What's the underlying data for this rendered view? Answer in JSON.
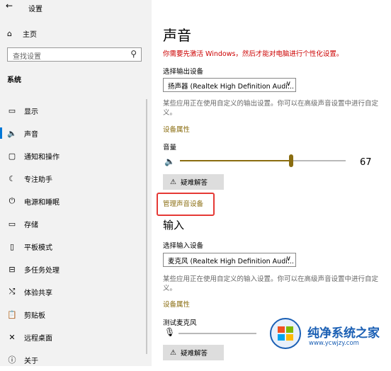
{
  "app": {
    "title": "设置",
    "back_icon": "←"
  },
  "sidebar": {
    "home": {
      "icon": "home-icon",
      "glyph": "⌂",
      "label": "主页"
    },
    "search": {
      "placeholder": "查找设置",
      "icon_glyph": "⚲"
    },
    "section": "系统",
    "items": [
      {
        "name": "display",
        "label": "显示",
        "glyph": "▭"
      },
      {
        "name": "sound",
        "label": "声音",
        "glyph": "🔈",
        "active": true
      },
      {
        "name": "notifications",
        "label": "通知和操作",
        "glyph": "▢"
      },
      {
        "name": "focus-assist",
        "label": "专注助手",
        "glyph": "☾"
      },
      {
        "name": "power-sleep",
        "label": "电源和睡眠",
        "glyph": "⏻"
      },
      {
        "name": "storage",
        "label": "存储",
        "glyph": "▭"
      },
      {
        "name": "tablet-mode",
        "label": "平板模式",
        "glyph": "▯"
      },
      {
        "name": "multitasking",
        "label": "多任务处理",
        "glyph": "⊟"
      },
      {
        "name": "project",
        "label": "体验共享",
        "glyph": "⤭"
      },
      {
        "name": "clipboard",
        "label": "剪贴板",
        "glyph": "📋"
      },
      {
        "name": "remote-desktop",
        "label": "远程桌面",
        "glyph": "✕"
      },
      {
        "name": "about",
        "label": "关于",
        "glyph": "ⓘ"
      }
    ]
  },
  "main": {
    "title": "声音",
    "warning": "你需要先激活 Windows，然后才能对电脑进行个性化设置。",
    "output": {
      "label": "选择输出设备",
      "device": "扬声器 (Realtek High Definition Audi...",
      "description": "某些应用正在使用自定义的输出设置。你可以在高级声音设置中进行自定义。",
      "properties_link": "设备属性",
      "volume_label": "音量",
      "volume": 67,
      "troubleshoot": "疑难解答",
      "manage_link": "管理声音设备"
    },
    "input": {
      "heading": "输入",
      "label": "选择输入设备",
      "device": "麦克风 (Realtek High Definition Audi...",
      "description": "某些应用正在使用自定义的输入设置。你可以在高级声音设置中进行自定义。",
      "properties_link": "设备属性",
      "test_label": "测试麦克风",
      "troubleshoot": "疑难解答"
    }
  },
  "watermark": {
    "line1": "纯净系统之家",
    "line2": "www.ycwjzy.com"
  },
  "colors": {
    "accent": "#8a6d10",
    "warning": "#cc0000",
    "highlight_box": "#e53935"
  }
}
